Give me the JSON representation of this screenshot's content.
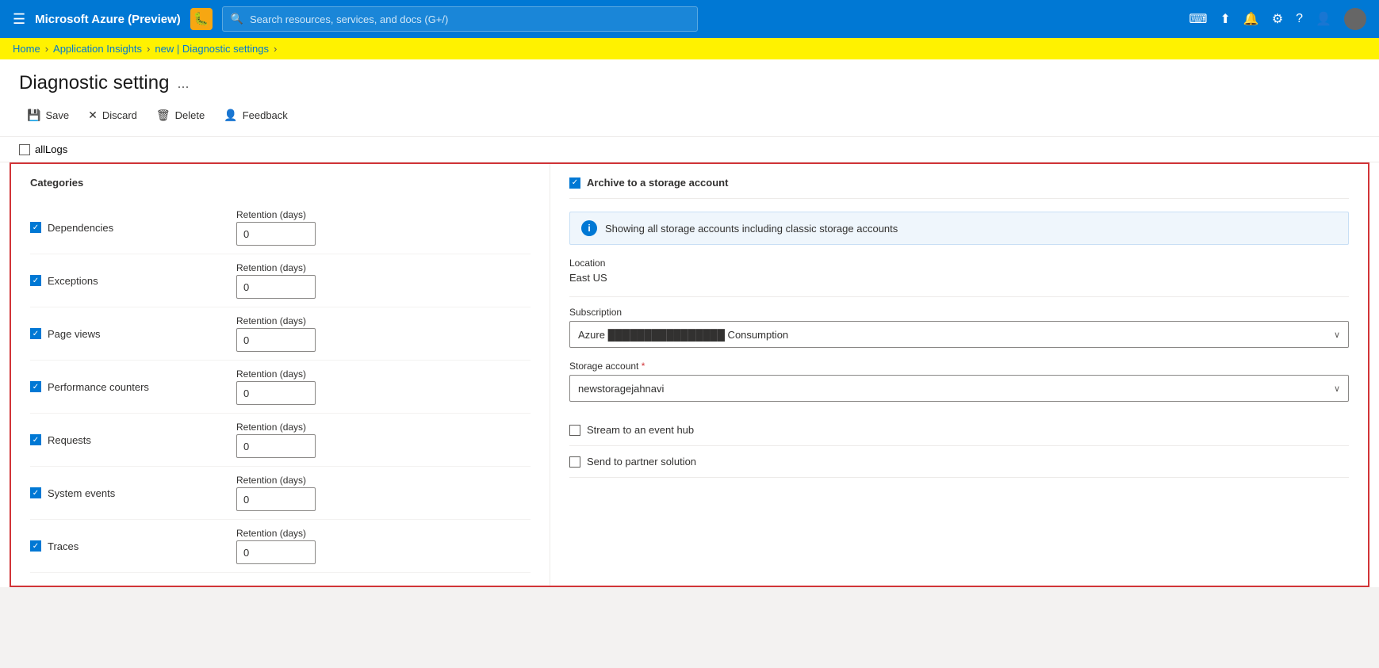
{
  "topnav": {
    "title": "Microsoft Azure (Preview)",
    "search_placeholder": "Search resources, services, and docs (G+/)"
  },
  "breadcrumb": {
    "items": [
      "Home",
      "Application Insights",
      "new | Diagnostic settings"
    ],
    "separators": [
      ">",
      ">",
      ">"
    ]
  },
  "page": {
    "title": "Diagnostic setting",
    "ellipsis": "..."
  },
  "toolbar": {
    "save_label": "Save",
    "discard_label": "Discard",
    "delete_label": "Delete",
    "feedback_label": "Feedback"
  },
  "alllogs": {
    "label": "allLogs"
  },
  "categories": {
    "title": "Categories",
    "items": [
      {
        "name": "Dependencies",
        "checked": true,
        "retention_label": "Retention (days)",
        "retention_value": "0"
      },
      {
        "name": "Exceptions",
        "checked": true,
        "retention_label": "Retention (days)",
        "retention_value": "0"
      },
      {
        "name": "Page views",
        "checked": true,
        "retention_label": "Retention (days)",
        "retention_value": "0"
      },
      {
        "name": "Performance counters",
        "checked": true,
        "retention_label": "Retention (days)",
        "retention_value": "0"
      },
      {
        "name": "Requests",
        "checked": true,
        "retention_label": "Retention (days)",
        "retention_value": "0"
      },
      {
        "name": "System events",
        "checked": true,
        "retention_label": "Retention (days)",
        "retention_value": "0"
      },
      {
        "name": "Traces",
        "checked": true,
        "retention_label": "Retention (days)",
        "retention_value": "0"
      }
    ]
  },
  "right_panel": {
    "archive_label": "Archive to a storage account",
    "archive_checked": true,
    "info_text": "Showing all storage accounts including classic storage accounts",
    "location_label": "Location",
    "location_value": "East US",
    "subscription_label": "Subscription",
    "subscription_value": "Azure                    Consumption",
    "storage_account_label": "Storage account",
    "storage_account_required": "*",
    "storage_account_value": "newstoragejahnavi",
    "stream_label": "Stream to an event hub",
    "stream_checked": false,
    "partner_label": "Send to partner solution",
    "partner_checked": false
  },
  "icons": {
    "hamburger": "☰",
    "bug": "🐛",
    "search": "🔍",
    "terminal": "▷",
    "cloud": "⬡",
    "bell": "🔔",
    "gear": "⚙",
    "help": "?",
    "user": "👤",
    "save": "💾",
    "discard": "✕",
    "delete": "🗑",
    "feedback": "👤",
    "check": "✓",
    "chevron_down": "∨",
    "info": "i"
  }
}
